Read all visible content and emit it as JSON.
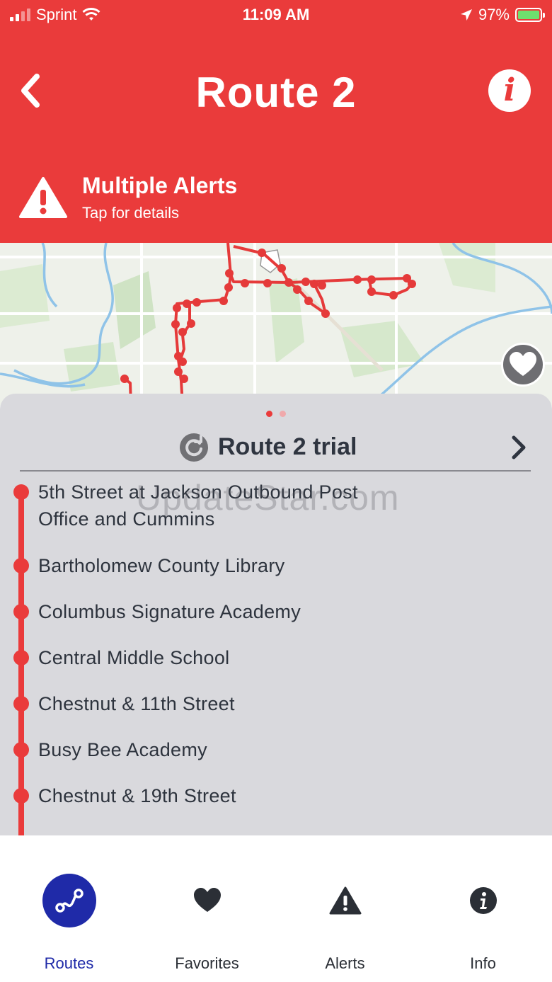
{
  "status_bar": {
    "carrier": "Sprint",
    "time": "11:09 AM",
    "battery": "97%"
  },
  "header": {
    "title": "Route 2"
  },
  "alert": {
    "title": "Multiple Alerts",
    "subtitle": "Tap for details"
  },
  "sheet": {
    "variant_title": "Route 2 trial",
    "watermark": "UpdateStar.com",
    "stops": [
      "5th Street at Jackson Outbound Post Office and Cummins",
      "Bartholomew County Library",
      "Columbus Signature Academy",
      "Central Middle School",
      "Chestnut & 11th Street",
      "Busy Bee Academy",
      "Chestnut & 19th Street"
    ]
  },
  "tabs": [
    {
      "label": "Routes",
      "icon": "route-icon",
      "active": true
    },
    {
      "label": "Favorites",
      "icon": "heart-icon",
      "active": false
    },
    {
      "label": "Alerts",
      "icon": "warning-icon",
      "active": false
    },
    {
      "label": "Info",
      "icon": "info-icon",
      "active": false
    }
  ],
  "colors": {
    "brand_red": "#ea3b3b",
    "active_blue": "#1f2aa8",
    "sheet_gray": "#d9d9dd"
  }
}
